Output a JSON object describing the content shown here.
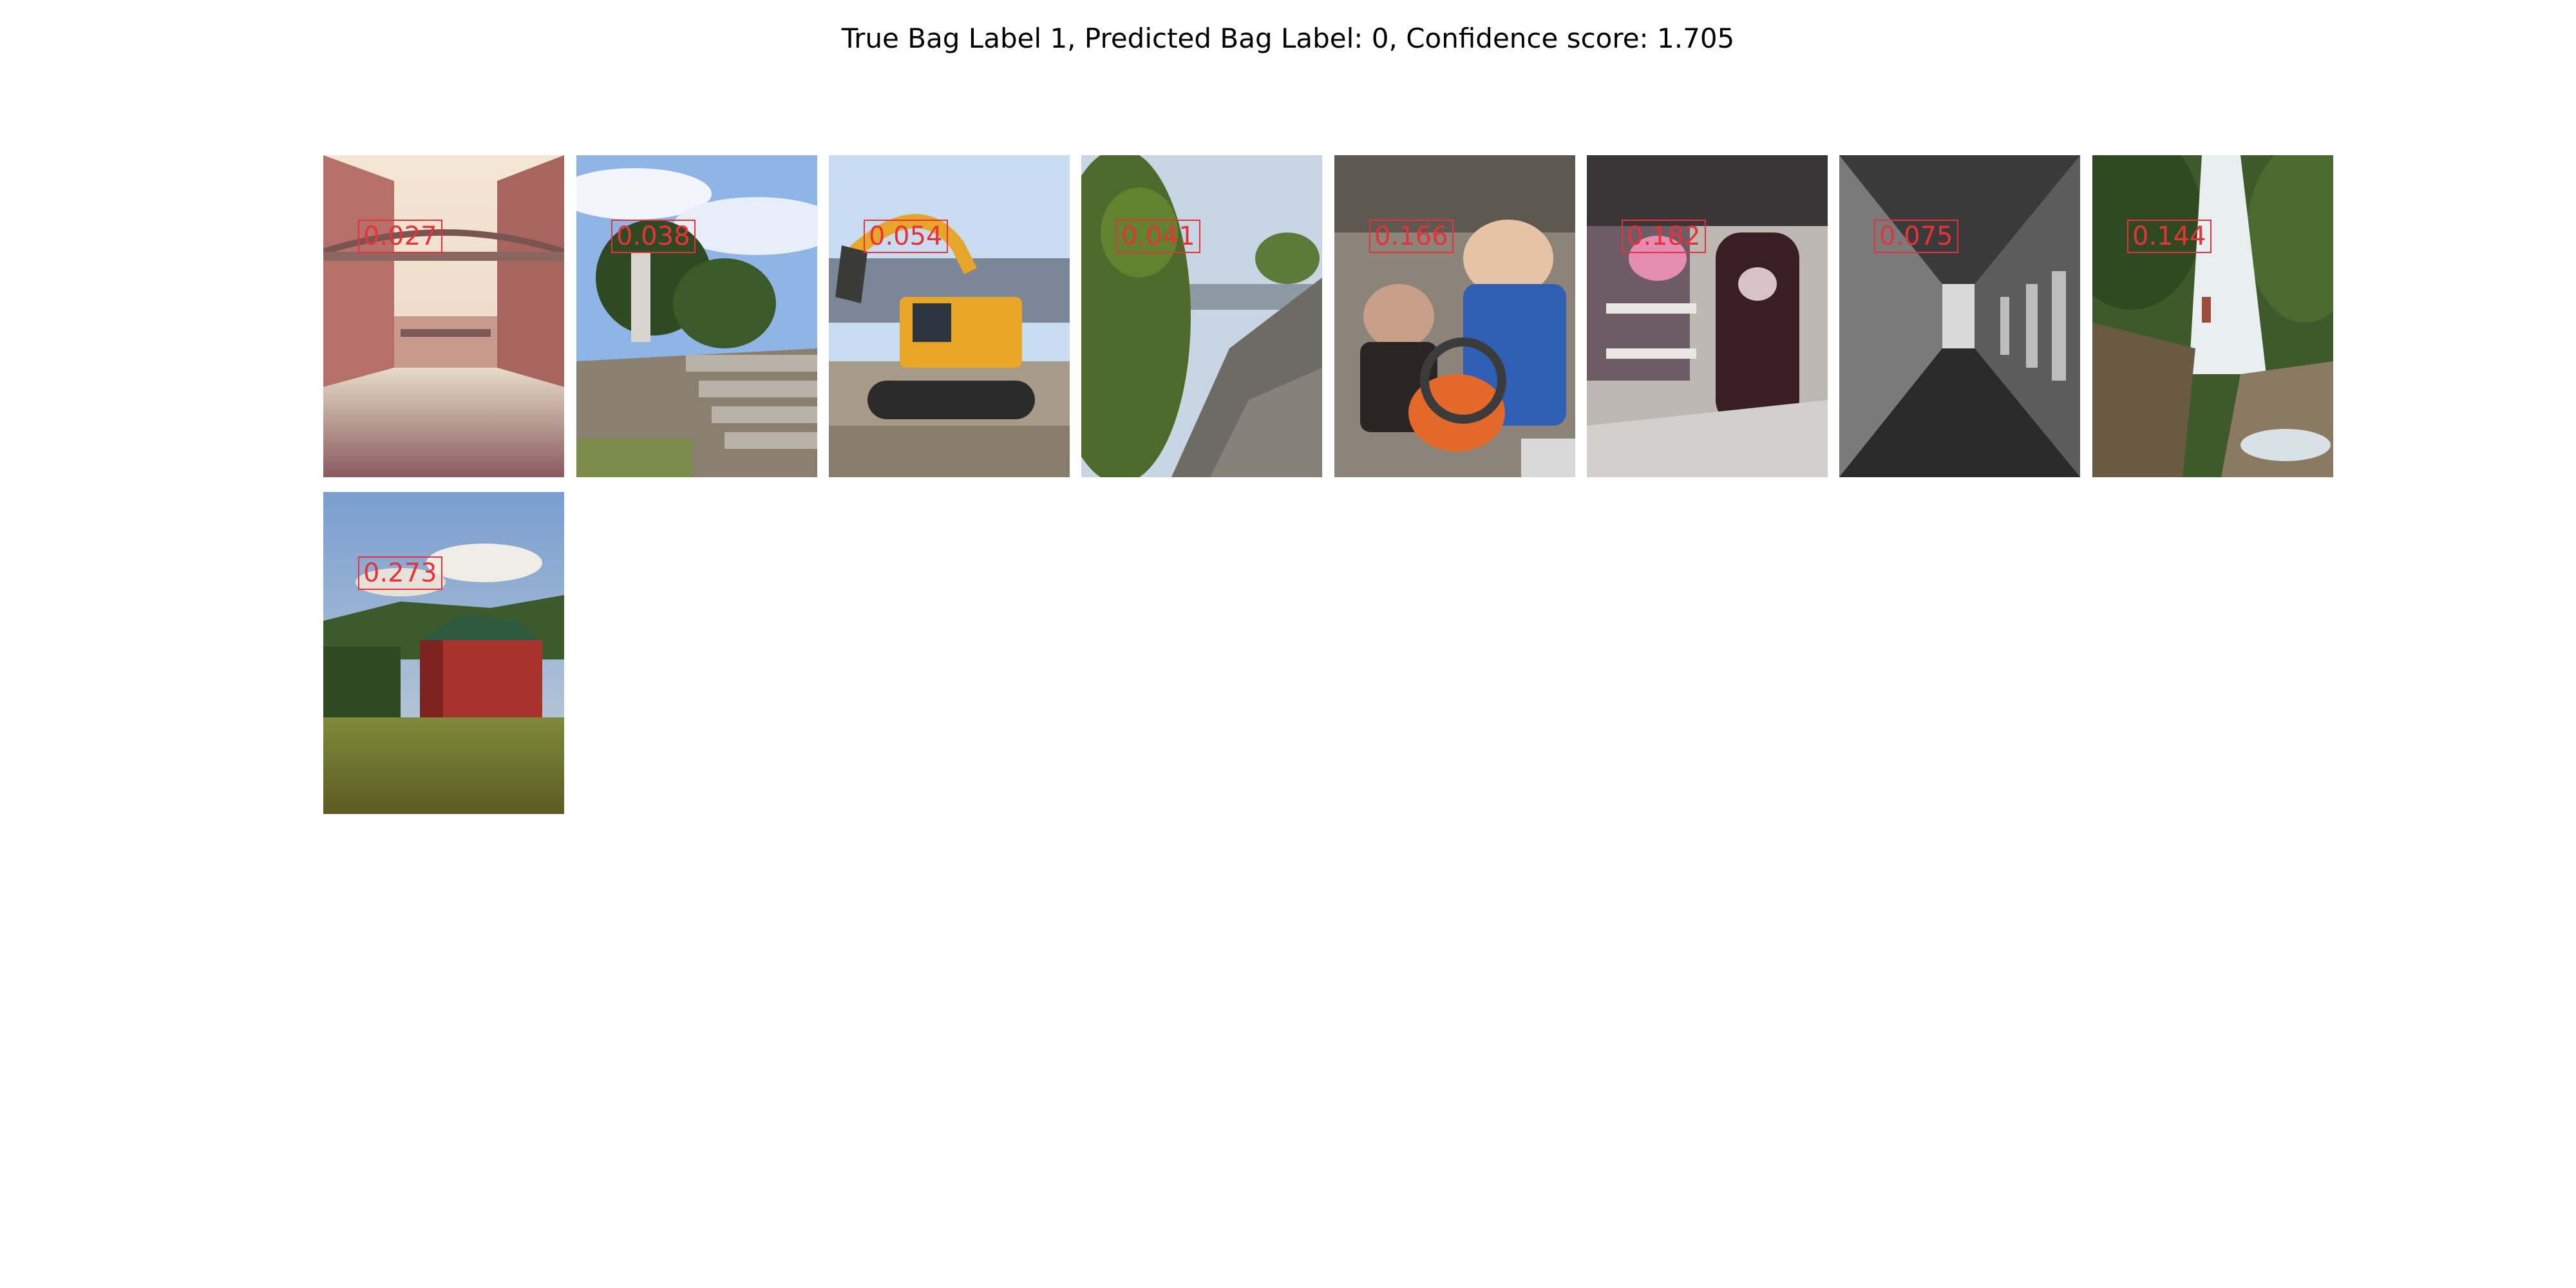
{
  "figure": {
    "title": "True Bag Label 1, Predicted Bag Label: 0, Confidence score: 1.705"
  },
  "instances": [
    {
      "score": "0.027",
      "image": "canal-between-brick-buildings-image"
    },
    {
      "score": "0.038",
      "image": "stone-steps-statue-trees-image"
    },
    {
      "score": "0.054",
      "image": "yellow-excavator-image"
    },
    {
      "score": "0.041",
      "image": "rocky-hillside-vegetation-image"
    },
    {
      "score": "0.166",
      "image": "workshop-people-machine-image"
    },
    {
      "score": "0.182",
      "image": "shop-interior-clothing-image"
    },
    {
      "score": "0.075",
      "image": "dark-corridor-image"
    },
    {
      "score": "0.144",
      "image": "waterfall-cliff-image"
    },
    {
      "score": "0.273",
      "image": "red-barn-field-image"
    }
  ],
  "colors": {
    "score_text": "#e8323a",
    "background": "#ffffff"
  }
}
